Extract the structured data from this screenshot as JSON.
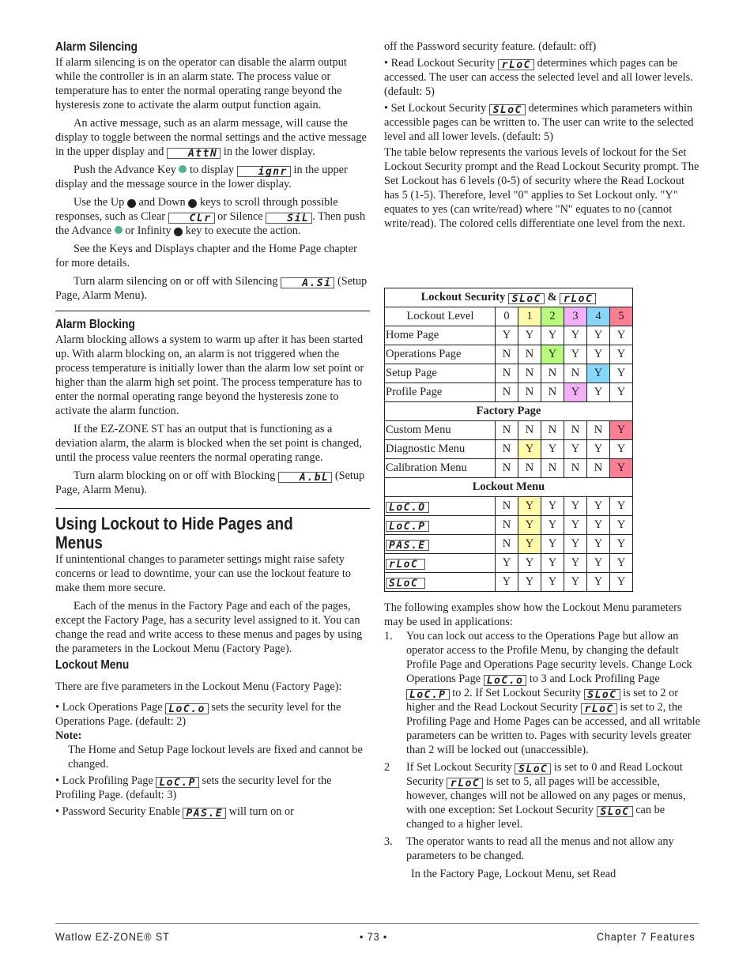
{
  "left": {
    "alarm_silencing": {
      "heading": "Alarm Silencing",
      "p1": "If alarm silencing is on the operator can disable the alarm output while the controller is in an alarm state. The process value or temperature has to enter the normal operating range beyond the hysteresis zone to activate the alarm output function again.",
      "p2_a": "An active message, such as an alarm message, will cause the display to toggle between the normal settings and the active message in the upper display and",
      "p2_code": "AttN",
      "p2_b": "in the lower display.",
      "p3_a": "Push the Advance Key",
      "p3_b": "to display",
      "p3_code": "ignr",
      "p3_c": "in the upper display and the message source in the lower display.",
      "p4_a": "Use the Up",
      "p4_b": "and Down",
      "p4_c": "keys to scroll through possible responses, such as Clear",
      "p4_code1": "CLr",
      "p4_d": "or Silence",
      "p4_code2": "SiL",
      "p4_e": ". Then push the Advance",
      "p4_f": "or Infinity",
      "p4_g": "key to execute the action.",
      "p5": "See the Keys and Displays chapter and the Home Page chapter for more details.",
      "p6_a": "Turn alarm silencing on or off with Silencing",
      "p6_code": "A.Si",
      "p6_b": "(Setup Page, Alarm Menu)."
    },
    "alarm_blocking": {
      "heading": "Alarm Blocking",
      "p1": "Alarm blocking allows a system to warm up after it has been started up. With alarm blocking on, an alarm is not triggered when the process temperature is initially lower than the alarm low set point or higher than the alarm high set point. The process temperature has to enter the normal operating range beyond the hysteresis zone to activate the alarm function.",
      "p2": "If the EZ-ZONE ST has an output that is functioning as a deviation alarm, the alarm is blocked when the set point is changed, until the process value reenters the normal operating range.",
      "p3_a": "Turn alarm blocking on or off with Blocking",
      "p3_code": "A.bL",
      "p3_b": "(Setup Page, Alarm Menu)."
    },
    "lockout": {
      "heading": "Using Lockout to Hide Pages and Menus",
      "p1": "If unintentional changes to parameter settings might raise safety concerns or lead to downtime, your can use the lockout feature to make them more secure.",
      "p2": "Each of the menus in the Factory Page and each of the pages, except the Factory Page, has a security level assigned to it. You can change the read and write access to these menus and pages by using the parameters in the Lockout Menu (Factory Page).",
      "subheading": "Lockout Menu",
      "p3": "There are five parameters in the Lockout Menu (Factory Page):",
      "b1_a": "• Lock Operations Page",
      "b1_code": "LoC.o",
      "b1_b": "sets the security level for the Operations Page. (default: 2)",
      "note_label": "Note:",
      "note_body": "The Home and Setup Page lockout levels are fixed and cannot be changed.",
      "b2_a": "• Lock Profiling Page",
      "b2_code": "LoC.P",
      "b2_b": "sets the security level for the Profiling Page. (default: 3)",
      "b3_a": "• Password Security Enable",
      "b3_code": "PAS.E",
      "b3_b": "will turn on or"
    }
  },
  "right": {
    "cont": "off the Password security feature. (default: off)",
    "b4_a": "• Read Lockout Security",
    "b4_code": "rLoC",
    "b4_b": "determines which pages can be accessed. The user can access the selected level and all lower levels. (default: 5)",
    "b5_a": "• Set Lockout Security",
    "b5_code": "SLoC",
    "b5_b": "determines which parameters within accessible pages can be written to. The user can write to the selected level and all lower levels. (default: 5)",
    "p_table": "The table below represents the various levels of lockout for the Set Lockout Security prompt and the Read Lockout Security prompt. The Set Lockout has 6 levels (0-5) of security where the Read Lockout has 5 (1-5). Therefore, level \"0\" applies to Set Lockout only. \"Y\" equates to yes (can write/read) where \"N\" equates to no (cannot write/read). The colored cells differentiate one level from the next.",
    "p_examples": "The following examples show how the Lockout Menu parameters may be used in applications:",
    "ex1_num": "1.",
    "ex1_a": "You can lock out access to the Operations Page but allow an operator access to the Profile Menu, by changing the default Profile Page and Operations Page security levels. Change Lock Operations Page",
    "ex1_code1": "LoC.o",
    "ex1_b": "to 3 and Lock Profiling Page",
    "ex1_code2": "LoC.P",
    "ex1_c": "to 2. If Set Lockout Security",
    "ex1_code3": "SLoC",
    "ex1_d": "is set to 2 or higher and the Read Lockout Security",
    "ex1_code4": "rLoC",
    "ex1_e": "is set to 2, the Profiling Page and Home Pages can be accessed, and all writable parameters can be written to. Pages with security levels greater than 2 will be locked out (unaccessible).",
    "ex2_num": "2",
    "ex2_a": "If Set Lockout Security",
    "ex2_code1": "SLoC",
    "ex2_b": "is set to 0 and Read Lockout Security",
    "ex2_code2": "rLoC",
    "ex2_c": "is set to 5, all pages will be accessible, however, changes will not be allowed on any pages or menus, with one exception: Set Lockout Security",
    "ex2_code3": "SLoC",
    "ex2_d": "can be changed to a higher level.",
    "ex3_num": "3.",
    "ex3": "The operator wants to read all the menus and not allow any parameters to be changed.",
    "ex3_cont": "In the Factory Page, Lockout Menu, set Read"
  },
  "table": {
    "title": "Lockout Security",
    "title_code1": "SLoC",
    "title_amp": "&",
    "title_code2": "rLoC",
    "level_label": "Lockout Level",
    "levels": [
      "0",
      "1",
      "2",
      "3",
      "4",
      "5"
    ],
    "level_colors": [
      "#ffffff",
      "#fffaaa",
      "#b8fb7a",
      "#f1b0f7",
      "#86d8fb",
      "#fb7f92"
    ],
    "sections": [
      {
        "heading": null,
        "rows": [
          {
            "label": "Home Page",
            "code": false,
            "values": [
              "Y",
              "Y",
              "Y",
              "Y",
              "Y",
              "Y"
            ],
            "highlight": null
          },
          {
            "label": "Operations Page",
            "code": false,
            "values": [
              "N",
              "N",
              "Y",
              "Y",
              "Y",
              "Y"
            ],
            "highlight": 2
          },
          {
            "label": "Setup Page",
            "code": false,
            "values": [
              "N",
              "N",
              "N",
              "N",
              "Y",
              "Y"
            ],
            "highlight": 4
          },
          {
            "label": "Profile Page",
            "code": false,
            "values": [
              "N",
              "N",
              "N",
              "Y",
              "Y",
              "Y"
            ],
            "highlight": 3
          }
        ]
      },
      {
        "heading": "Factory Page",
        "rows": [
          {
            "label": "Custom Menu",
            "code": false,
            "values": [
              "N",
              "N",
              "N",
              "N",
              "N",
              "Y"
            ],
            "highlight": 5
          },
          {
            "label": "Diagnostic Menu",
            "code": false,
            "values": [
              "N",
              "Y",
              "Y",
              "Y",
              "Y",
              "Y"
            ],
            "highlight": 1
          },
          {
            "label": "Calibration Menu",
            "code": false,
            "values": [
              "N",
              "N",
              "N",
              "N",
              "N",
              "Y"
            ],
            "highlight": 5
          }
        ]
      },
      {
        "heading": "Lockout Menu",
        "rows": [
          {
            "label": "LoC.O",
            "code": true,
            "values": [
              "N",
              "Y",
              "Y",
              "Y",
              "Y",
              "Y"
            ],
            "highlight": 1
          },
          {
            "label": "LoC.P",
            "code": true,
            "values": [
              "N",
              "Y",
              "Y",
              "Y",
              "Y",
              "Y"
            ],
            "highlight": 1
          },
          {
            "label": "PAS.E",
            "code": true,
            "values": [
              "N",
              "Y",
              "Y",
              "Y",
              "Y",
              "Y"
            ],
            "highlight": 1
          },
          {
            "label": "rLoC",
            "code": true,
            "values": [
              "Y",
              "Y",
              "Y",
              "Y",
              "Y",
              "Y"
            ],
            "highlight": null
          },
          {
            "label": "SLoC",
            "code": true,
            "values": [
              "Y",
              "Y",
              "Y",
              "Y",
              "Y",
              "Y"
            ],
            "highlight": null
          }
        ]
      }
    ]
  },
  "footer": {
    "left": "Watlow EZ-ZONE® ST",
    "center": "• 73 •",
    "right": "Chapter 7 Features"
  },
  "colors": {
    "advance_key": "#4fb58a",
    "text": "#231f20"
  }
}
